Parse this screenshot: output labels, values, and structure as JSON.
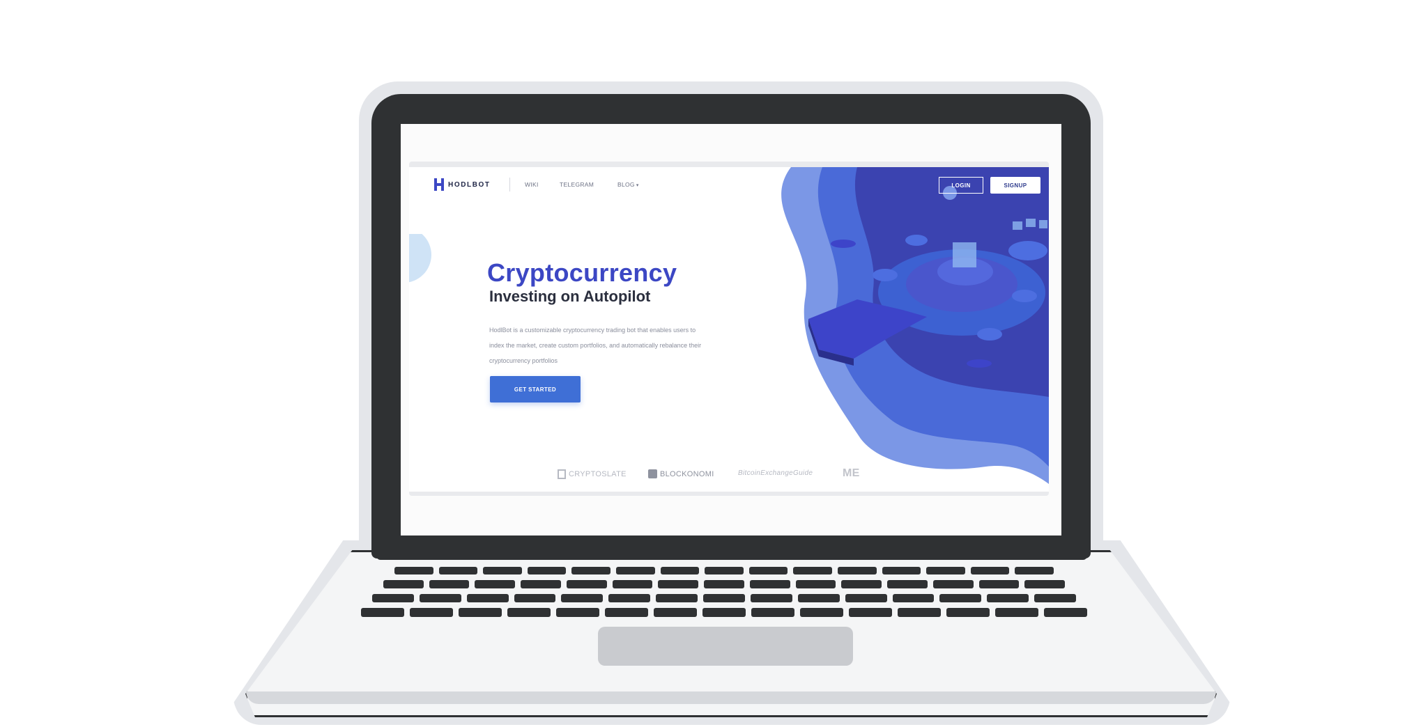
{
  "nav": {
    "brand": "HODLBOT",
    "links": [
      {
        "label": "WIKI"
      },
      {
        "label": "TELEGRAM"
      },
      {
        "label": "BLOG"
      }
    ],
    "login": "LOGIN",
    "signup": "SIGNUP"
  },
  "hero": {
    "title": "Cryptocurrency",
    "subtitle": "Investing on Autopilot",
    "description": "HodlBot is a customizable cryptocurrency trading bot that enables users to index the market, create custom portfolios, and automatically rebalance their cryptocurrency portfolios",
    "cta": "GET STARTED"
  },
  "press": {
    "logos": [
      {
        "label": "CRYPTOSLATE"
      },
      {
        "label": "BLOCKONOMI"
      },
      {
        "label": "BitcoinExchangeGuide"
      },
      {
        "label": "ME"
      }
    ]
  },
  "colors": {
    "primary": "#3c47c4",
    "hero_bg_dark": "#3b43b0",
    "hero_bg_mid": "#4a6ad8",
    "hero_bg_light": "#7b97e6",
    "cta": "#3f6fd6",
    "laptop_frame": "#2f3133"
  },
  "icons": {
    "brand": "hodlbot-h-logo",
    "blog_caret": "caret-down-icon"
  }
}
